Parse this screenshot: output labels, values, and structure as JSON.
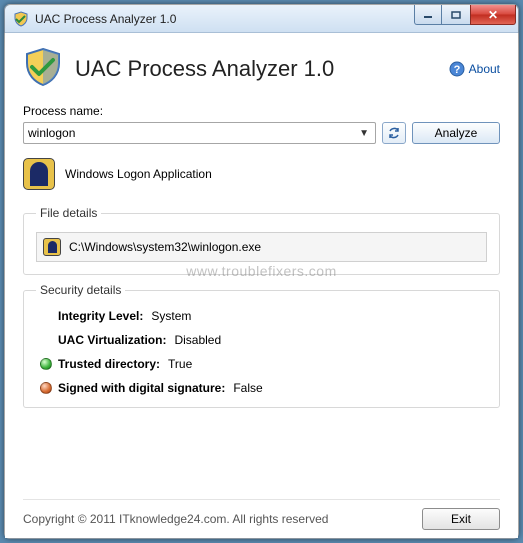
{
  "window": {
    "title": "UAC Process Analyzer 1.0"
  },
  "header": {
    "app_title": "UAC Process Analyzer 1.0",
    "about_label": "About"
  },
  "process": {
    "label": "Process name:",
    "value": "winlogon",
    "analyze_label": "Analyze",
    "display_name": "Windows Logon Application"
  },
  "file_details": {
    "legend": "File details",
    "path": "C:\\Windows\\system32\\winlogon.exe"
  },
  "security": {
    "legend": "Security details",
    "integrity_label": "Integrity Level:",
    "integrity_value": "System",
    "uacvirt_label": "UAC Virtualization:",
    "uacvirt_value": "Disabled",
    "trusted_label": "Trusted directory:",
    "trusted_value": "True",
    "signed_label": "Signed with digital signature:",
    "signed_value": "False"
  },
  "footer": {
    "copyright": "Copyright © 2011 ITknowledge24.com. All rights reserved",
    "exit_label": "Exit"
  },
  "watermark": "www.troublefixers.com"
}
